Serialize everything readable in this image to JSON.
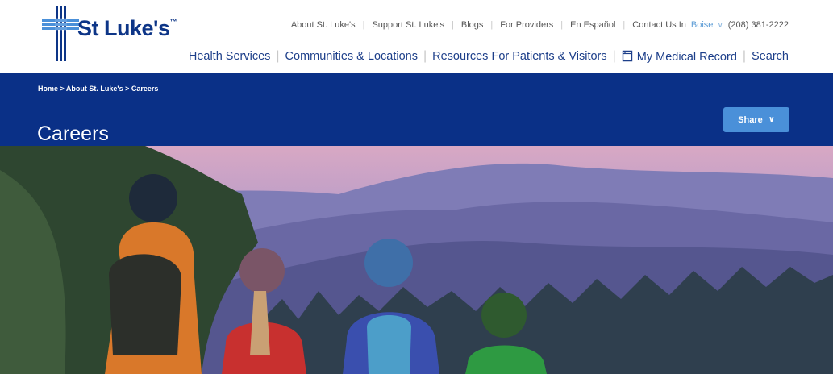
{
  "logo": {
    "name": "St Luke's",
    "mark": "™"
  },
  "utility_nav": {
    "links": [
      "About St. Luke's",
      "Support St. Luke's",
      "Blogs",
      "For Providers",
      "En Español"
    ],
    "contact_label": "Contact Us In",
    "city": "Boise",
    "phone": "(208) 381-2222"
  },
  "main_nav": {
    "items": [
      "Health Services",
      "Communities & Locations",
      "Resources For Patients & Visitors"
    ],
    "medical_record": "My Medical Record",
    "search": "Search"
  },
  "breadcrumb": "Home > About St. Luke's > Careers",
  "page_title": "Careers",
  "share_label": "Share",
  "colors": {
    "brand": "#0a3087",
    "accent": "#4a90d9",
    "nav_text": "#1d3f8a"
  }
}
